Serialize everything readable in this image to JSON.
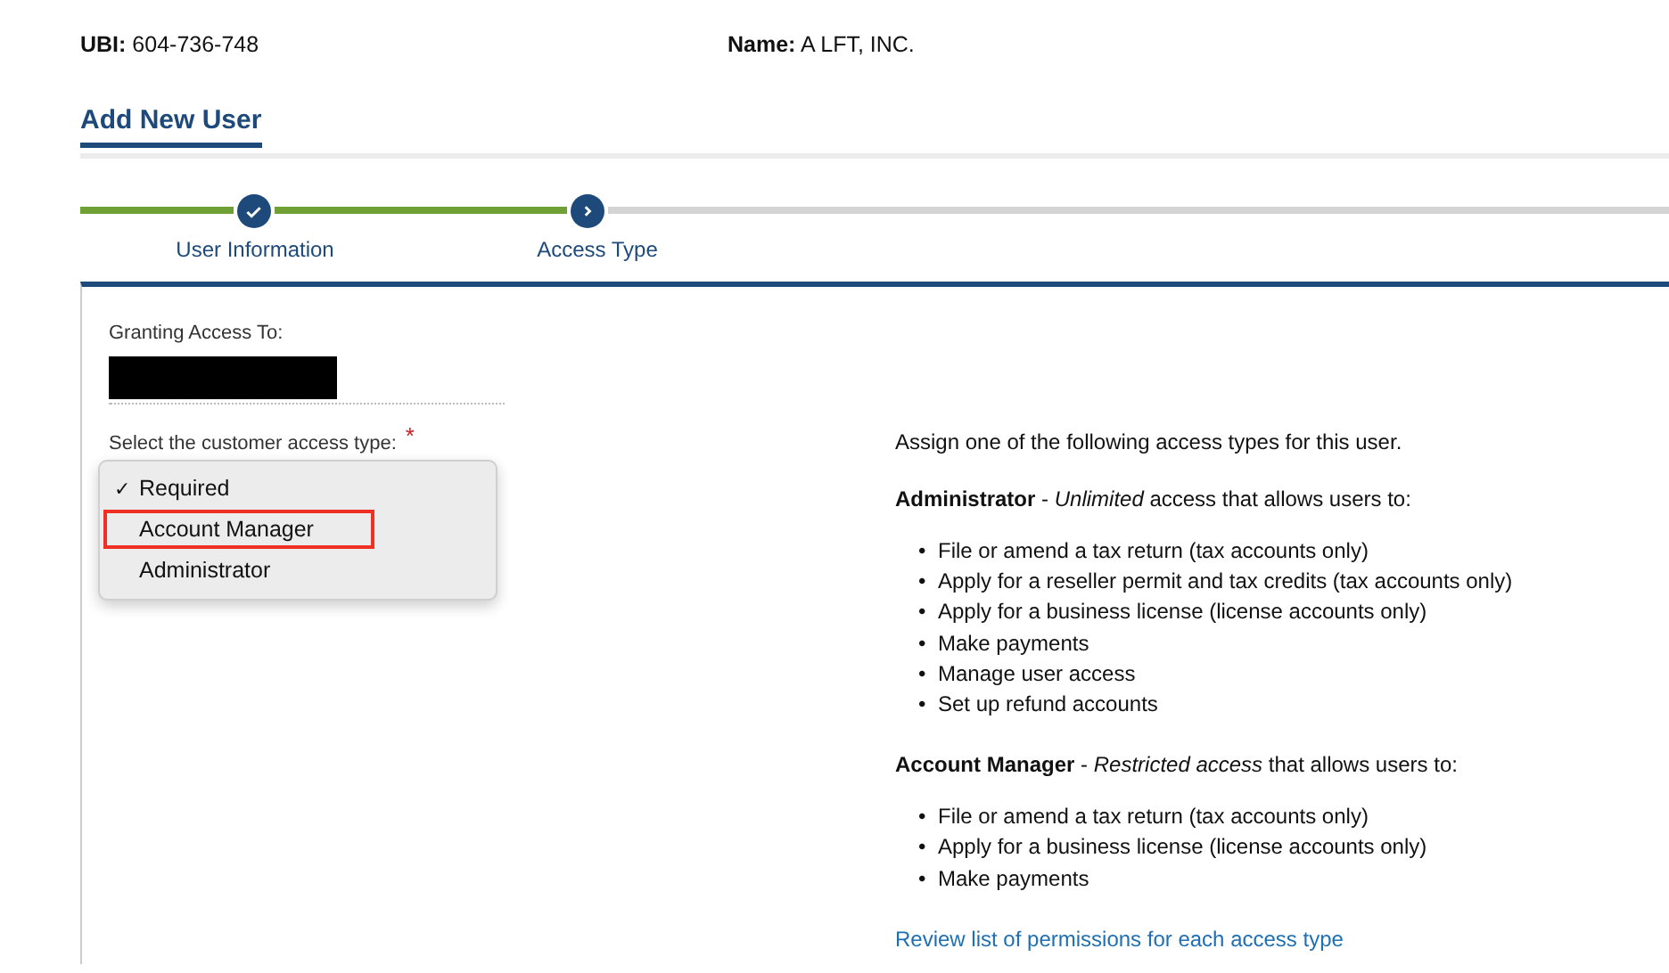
{
  "header": {
    "ubi_label": "UBI:",
    "ubi": "604-736-748",
    "name_label": "Name:",
    "name": "A LFT, INC."
  },
  "page_tab": {
    "label": "Add New User",
    "selected": true
  },
  "steps": [
    {
      "label": "User Information",
      "kind": "done"
    },
    {
      "label": "Access Type",
      "kind": "current"
    }
  ],
  "form": {
    "granting_label": "Granting Access To:",
    "access_label": "Select the customer access type:",
    "required_mark": "*",
    "dropdown": [
      {
        "label": "Required",
        "checked": true,
        "outlined": false
      },
      {
        "label": "Account Manager",
        "checked": false,
        "outlined": true
      },
      {
        "label": "Administrator",
        "checked": false,
        "outlined": false
      }
    ],
    "check_mark": "✓"
  },
  "info": {
    "intro": "Assign one of the following access types for this user.",
    "sections": [
      {
        "heading": "**Administrator** - *Unlimited* access that allows users to:",
        "items": [
          "File or amend a tax return (tax accounts only)",
          "Apply for a reseller permit and tax credits (tax accounts only)",
          "Apply for a business license (license accounts only)",
          "Make payments",
          "Manage user access",
          "Set up refund accounts"
        ]
      },
      {
        "heading": "**Account Manager** - *Restricted access* that allows users to:",
        "items": [
          "File or amend a tax return (tax accounts only)",
          "Apply for a business license (license accounts only)",
          "Make payments"
        ]
      }
    ],
    "bullet": "•",
    "link": "Review list of permissions for each access type"
  }
}
